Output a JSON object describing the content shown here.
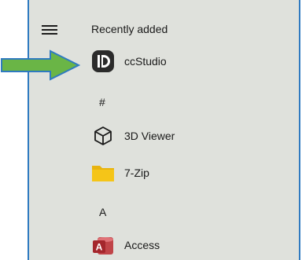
{
  "start_menu": {
    "section_title": "Recently added",
    "hamburger_icon": "hamburger-menu-icon",
    "recent_apps": [
      {
        "label": "ccStudio",
        "icon": "ccstudio-icon"
      }
    ],
    "groups": [
      {
        "letter": "#",
        "apps": [
          {
            "label": "3D Viewer",
            "icon": "cube-outline-icon"
          },
          {
            "label": "7-Zip",
            "icon": "folder-icon"
          }
        ]
      },
      {
        "letter": "A",
        "apps": [
          {
            "label": "Access",
            "icon": "access-icon"
          }
        ]
      }
    ]
  },
  "annotation": {
    "arrow_color": "#6ab546",
    "arrow_outline": "#2f7ac0"
  },
  "colors": {
    "panel_background": "#dfe1dc",
    "panel_border": "#2f7ac0",
    "folder_yellow": "#f5c518",
    "access_red": "#a4262c"
  }
}
